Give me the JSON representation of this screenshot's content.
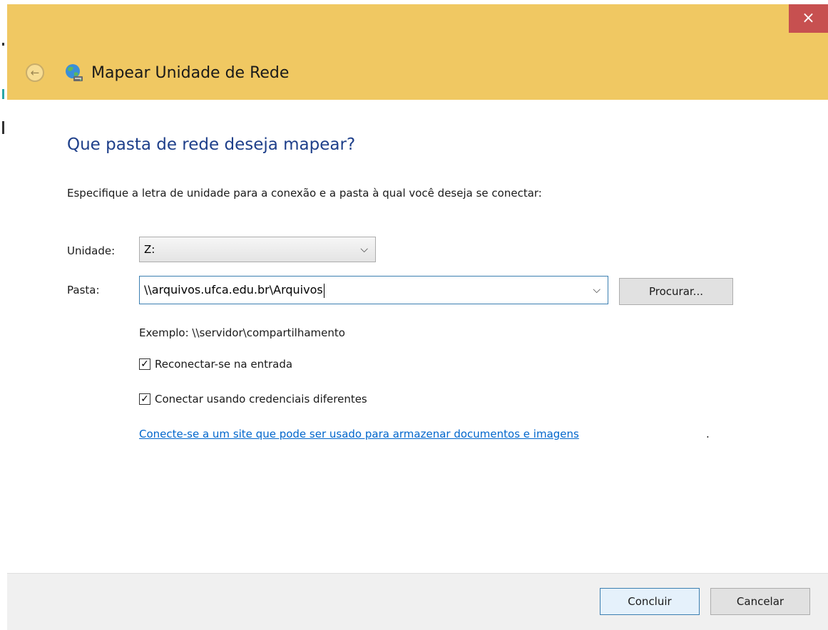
{
  "window": {
    "title": "Mapear Unidade de Rede",
    "close_glyph": "×",
    "back_glyph": "←",
    "back_icon": "back-arrow-icon",
    "app_icon": "network-drive-icon"
  },
  "heading": "Que pasta de rede deseja mapear?",
  "instruction": "Especifique a letra de unidade para a conexão e a pasta à qual você deseja se conectar:",
  "drive": {
    "label": "Unidade:",
    "value": "Z:"
  },
  "folder": {
    "label": "Pasta:",
    "value": "\\\\arquivos.ufca.edu.br\\Arquivos",
    "browse_label": "Procurar..."
  },
  "example": "Exemplo: \\\\servidor\\compartilhamento",
  "options": {
    "reconnect_label": "Reconectar-se na entrada",
    "reconnect_checked": true,
    "credentials_label": "Conectar usando credenciais diferentes",
    "credentials_checked": true
  },
  "link": {
    "text": "Conecte-se a um site que pode ser usado para armazenar documentos e imagens",
    "suffix": "."
  },
  "footer": {
    "finish_label": "Concluir",
    "cancel_label": "Cancelar"
  },
  "colors": {
    "title_bar": "#f0c862",
    "close_button": "#c75050",
    "heading": "#1e3f8a",
    "link": "#0066cc"
  }
}
